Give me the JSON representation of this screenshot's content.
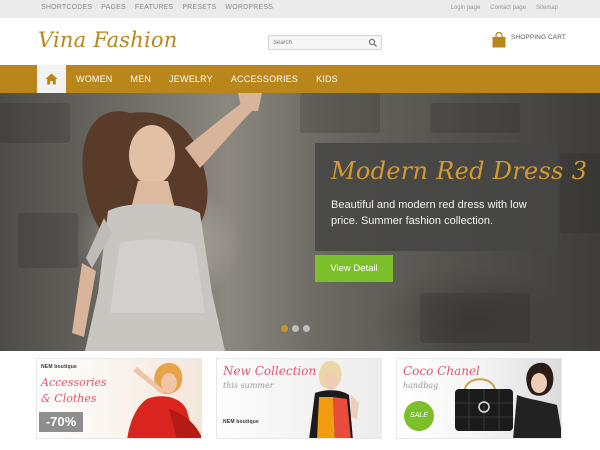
{
  "top_links": [
    "SHORTCODES",
    "PAGES",
    "FEATURES",
    "PRESETS",
    "WORDPRESS"
  ],
  "account_links": [
    "Login page",
    "Contact page",
    "Sitemap"
  ],
  "header": {
    "logo": "Vina Fashion",
    "search_placeholder": "Search",
    "cart_label": "SHOPPING CART"
  },
  "nav": {
    "home_icon": "home-icon",
    "items": [
      "WOMEN",
      "MEN",
      "JEWELRY",
      "ACCESSORIES",
      "KIDS"
    ]
  },
  "slider": {
    "title": "Modern Red Dress 3",
    "description": "Beautiful and modern red dress with low price. Summer fashion collection.",
    "cta": "View Detail",
    "slide_count": 3,
    "active_slide": 1
  },
  "banners": [
    {
      "brand": "NEM boutique",
      "title_line1": "Accessories",
      "title_line2": "& Clothes",
      "badge": "-70%"
    },
    {
      "title": "New Collection",
      "subtitle": "this summer",
      "brand": "NEM boutique"
    },
    {
      "title": "Coco Chanel",
      "subtitle": "handbag",
      "badge": "SALE"
    }
  ],
  "colors": {
    "brand_gold": "#b8861b",
    "accent_green": "#7bbf2b",
    "banner_pink": "#e0546e"
  }
}
